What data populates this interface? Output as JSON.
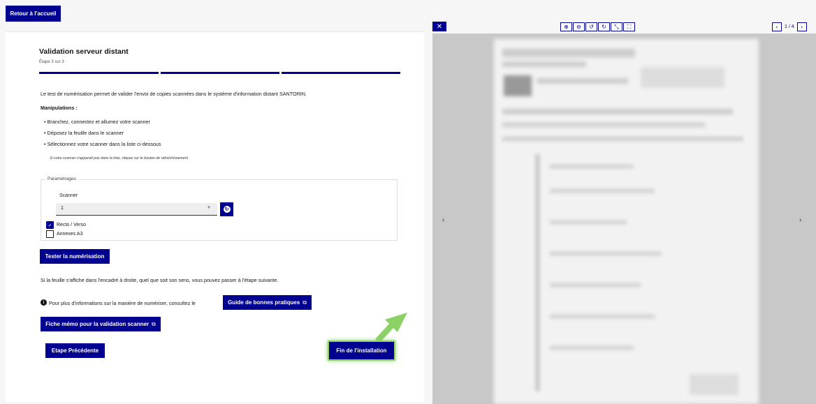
{
  "header": {
    "back_label": "Retour à l'accueil"
  },
  "wizard": {
    "title": "Validation serveur distant",
    "step": "Étape 3 sur 3",
    "intro": "Le test de numérisation permet de valider l'envoi de copies scannées dans le système d'information distant SANTORIN.",
    "manipulations_title": "Manipulations :",
    "steps": [
      "Branchez, connectez et allumez votre scanner",
      "Déposez la feuille dans le scanner",
      "Sélectionnez votre scanner dans la liste ci-dessous"
    ],
    "hint": "Si votre scanner n'apparaît pas dans la liste, cliquez sur le bouton de rafraîchissement",
    "settings": {
      "legend": "Paramétrages",
      "scanner_label": "Scanner",
      "scanner_value": "1",
      "recto_verso_label": "Recto / Verso",
      "recto_verso_checked": true,
      "annexes_label": "Annexes A3",
      "annexes_checked": false
    },
    "test_button": "Tester la numérisation",
    "leaf_text": "Si la feuille s'affiche dans l'encadré à droite, quel que soit son sens, vous pouvez passer à l'étape suivante.",
    "info_text": "Pour plus d'informations sur la manière de numériser, consultez le",
    "guide_button": "Guide de bonnes pratiques",
    "memo_button": "Fiche mémo pour la validation scanner",
    "prev_button": "Etape Précédente",
    "finish_button": "Fin de l'installation"
  },
  "viewer": {
    "page_indicator": "1 / 4"
  },
  "colors": {
    "primary": "#000091",
    "highlight": "#8cd165"
  },
  "icons": {
    "close": "close-icon",
    "zoom_in": "zoom-in-icon",
    "zoom_out": "zoom-out-icon",
    "rotate_left": "rotate-left-icon",
    "rotate_right": "rotate-right-icon",
    "fit": "fit-page-icon",
    "fullscreen": "fullscreen-icon",
    "refresh": "refresh-icon",
    "info": "info-icon",
    "external_link": "external-link-icon"
  }
}
